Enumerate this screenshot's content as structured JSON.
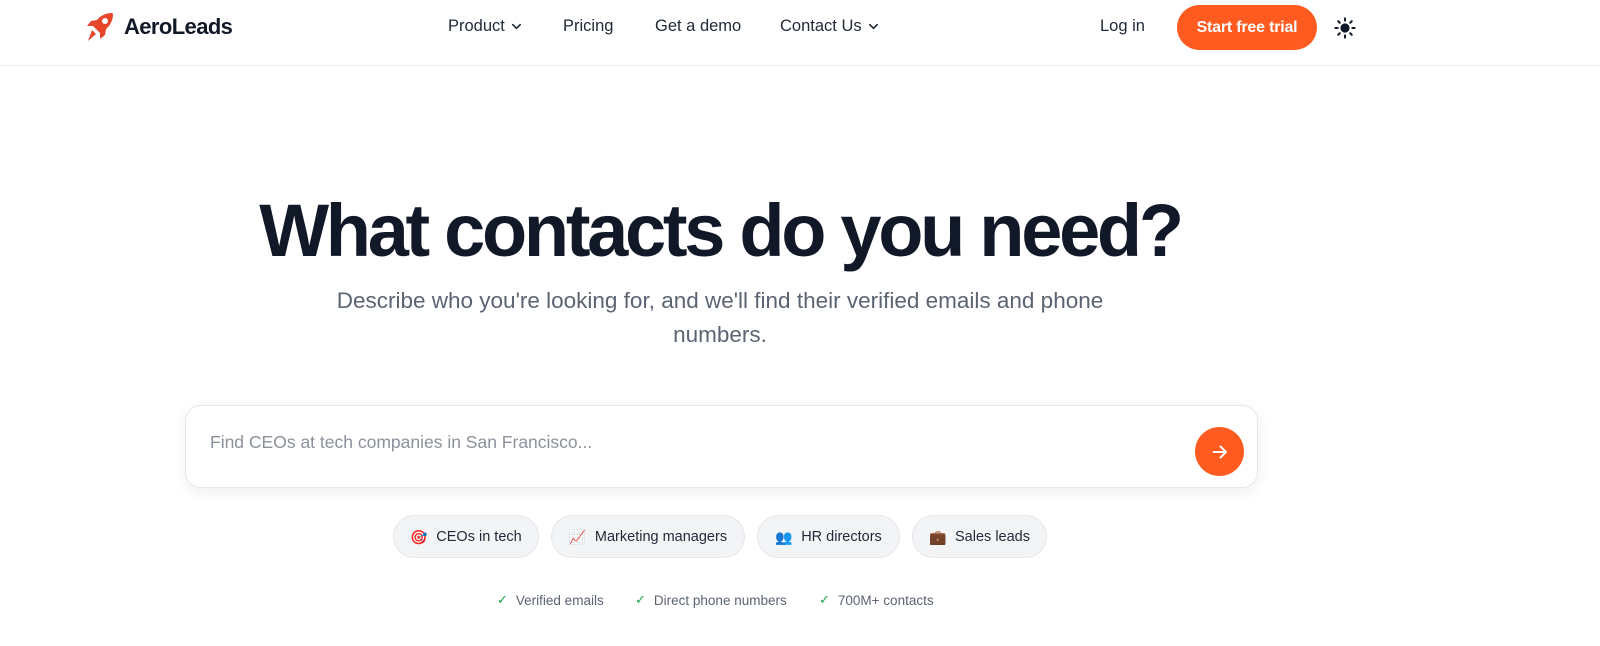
{
  "brand": {
    "name": "AeroLeads",
    "logo_icon": "rocket-icon",
    "accent_color": "#ff5a1f"
  },
  "nav": {
    "items": [
      {
        "label": "Product",
        "has_dropdown": true
      },
      {
        "label": "Pricing",
        "has_dropdown": false
      },
      {
        "label": "Get a demo",
        "has_dropdown": false
      },
      {
        "label": "Contact Us",
        "has_dropdown": true
      }
    ],
    "login_label": "Log in",
    "cta_label": "Start free trial",
    "theme_icon": "sun-icon"
  },
  "hero": {
    "title": "What contacts do you need?",
    "subtitle": "Describe who you're looking for, and we'll find their verified emails and phone numbers."
  },
  "search": {
    "placeholder": "Find CEOs at tech companies in San Francisco...",
    "value": "",
    "submit_icon": "arrow-right-icon"
  },
  "suggestions": [
    {
      "icon": "🎯",
      "label": "CEOs in tech"
    },
    {
      "icon": "📈",
      "label": "Marketing managers"
    },
    {
      "icon": "👥",
      "label": "HR directors"
    },
    {
      "icon": "💼",
      "label": "Sales leads"
    }
  ],
  "trust_badges": [
    {
      "icon": "✓",
      "label": "Verified emails"
    },
    {
      "icon": "✓",
      "label": "Direct phone numbers"
    },
    {
      "icon": "✓",
      "label": "700M+ contacts"
    }
  ]
}
